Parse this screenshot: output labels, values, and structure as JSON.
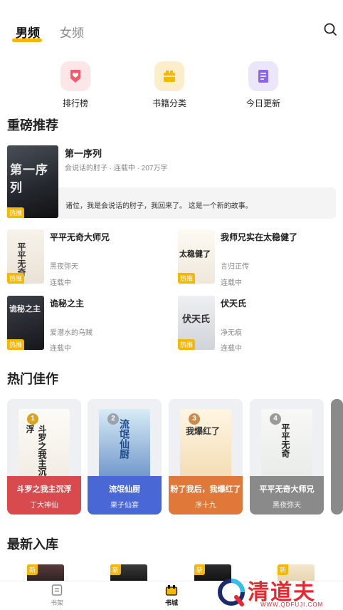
{
  "tabs": {
    "male": "男频",
    "female": "女频"
  },
  "quick_entries": [
    {
      "label": "排行榜",
      "icon": "ranking-icon",
      "color": "#f25b6b"
    },
    {
      "label": "书籍分类",
      "icon": "category-icon",
      "color": "#f5b800"
    },
    {
      "label": "今日更新",
      "icon": "update-icon",
      "color": "#8a67e8"
    }
  ],
  "sections": {
    "featured": "重磅推荐",
    "hot": "热门佳作",
    "new": "最新入库"
  },
  "featured_book": {
    "title": "第一序列",
    "meta": "会说话的肘子 · 连载中 · 207万字",
    "desc": "诸位，我是会说话的肘子，我回来了。 这是一个新的故事。",
    "cover_text": "第一序列",
    "badge": "热推"
  },
  "grid_books": [
    {
      "title": "平平无奇大师兄",
      "author": "黑夜弥天",
      "status": "连载中",
      "badge": "热推",
      "cover_text": "平平无奇"
    },
    {
      "title": "我师兄实在太稳健了",
      "author": "言归正传",
      "status": "连载中",
      "badge": "热推",
      "cover_text": "太稳健了"
    },
    {
      "title": "诡秘之主",
      "author": "爱潜水的乌贼",
      "status": "连载中",
      "badge": "热推",
      "cover_text": "诡秘之主"
    },
    {
      "title": "伏天氏",
      "author": "净无痕",
      "status": "连载中",
      "badge": "热推",
      "cover_text": "伏天氏"
    }
  ],
  "hot_books": [
    {
      "rank": "1",
      "title": "斗罗之我主沉浮",
      "author": "丁大神仙",
      "color": "#d94a4f",
      "cover_text": "斗罗之我主沉浮"
    },
    {
      "rank": "2",
      "title": "流氓仙厨",
      "author": "果子仙宴",
      "color": "#4a67d6",
      "cover_text": "流氓仙厨"
    },
    {
      "rank": "3",
      "title": "粉了我后，我爆红了",
      "author": "序十九",
      "color": "#e0783a",
      "cover_text": "我爆红了"
    },
    {
      "rank": "4",
      "title": "平平无奇大师兄",
      "author": "黑夜弥天",
      "color": "#8a8a8a",
      "cover_text": "平平无奇"
    }
  ],
  "new_badge": "新",
  "bottom_nav": [
    {
      "label": "书架",
      "icon": "bookshelf-icon"
    },
    {
      "label": "书城",
      "icon": "bookstore-icon"
    }
  ],
  "watermark": {
    "text": "清道夫",
    "sub": "WWW.QDFUJI.COM"
  }
}
